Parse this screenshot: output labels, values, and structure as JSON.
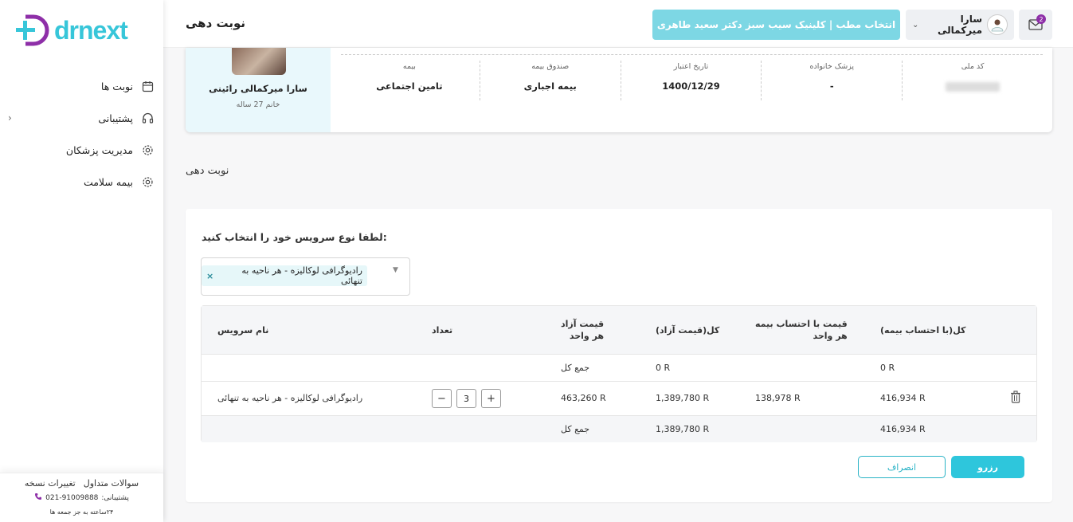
{
  "header": {
    "page_title": "نوبت دهی",
    "clinic_button": "انتخاب مطب | کلینیک سیب سبز دکتر سعید طاهری",
    "user_name": "سارا میرکمالی",
    "mail_badge": "2"
  },
  "sidebar": {
    "logo_text": "drnext",
    "items": [
      {
        "label": "نوبت ها",
        "icon": "calendar-icon"
      },
      {
        "label": "پشتیبانی",
        "icon": "headset-icon"
      },
      {
        "label": "مدیریت پزشکان",
        "icon": "gear-icon"
      },
      {
        "label": "بیمه سلامت",
        "icon": "gear-icon"
      }
    ],
    "footer": {
      "faq": "سوالات متداول",
      "changelog": "تغییرات نسخه",
      "support_label": "پشتیبانی:",
      "phone": "021-91009888",
      "hours": "۲۴ساعته به جز جمعه ها"
    }
  },
  "patient": {
    "name": "سارا میرکمالی رائینی",
    "sub": "خانم 27 ساله",
    "fields": [
      {
        "label": "کد ملی",
        "value": ""
      },
      {
        "label": "پزشک خانواده",
        "value": "-"
      },
      {
        "label": "تاریخ اعتبار",
        "value": "1400/12/29"
      },
      {
        "label": "صندوق بیمه",
        "value": "بیمه اجباری"
      },
      {
        "label": "بیمه",
        "value": "تامین اجتماعی"
      }
    ]
  },
  "section_title": "نوبت دهی",
  "form": {
    "prompt": "لطفا نوع سرویس خود را انتخاب کنید:",
    "selected_service": "رادیوگرافی لوکالیزه - هر ناحیه به تنهائی"
  },
  "table": {
    "headers": {
      "service_name": "نام سرویس",
      "quantity": "تعداد",
      "free_price_unit_1": "قیمت آزاد",
      "free_price_unit_2": "هر واحد",
      "total_free": "کل(قیمت آزاد)",
      "insured_unit_1": "قیمت با احتساب بیمه",
      "insured_unit_2": "هر واحد",
      "total_insured": "کل(با احتساب بیمه)"
    },
    "sum_row_top": {
      "label": "جمع کل",
      "total_free": "0 R",
      "total_insured": "0 R"
    },
    "item_row": {
      "service_name": "رادیوگرافی لوکالیزه - هر ناحیه به تنهائی",
      "quantity": "3",
      "minus": "−",
      "plus": "+",
      "free_unit": "463,260 R",
      "total_free": "1,389,780 R",
      "insured_unit": "138,978 R",
      "total_insured": "416,934 R"
    },
    "sum_row_bottom": {
      "label": "جمع کل",
      "total_free": "1,389,780 R",
      "total_insured": "416,934 R"
    }
  },
  "actions": {
    "submit": "رزرو",
    "cancel": "انصراف"
  },
  "colors": {
    "accent": "#2ec6dc",
    "clinic_button": "#7dd7e4",
    "brand_purple": "#8e2fa8"
  }
}
